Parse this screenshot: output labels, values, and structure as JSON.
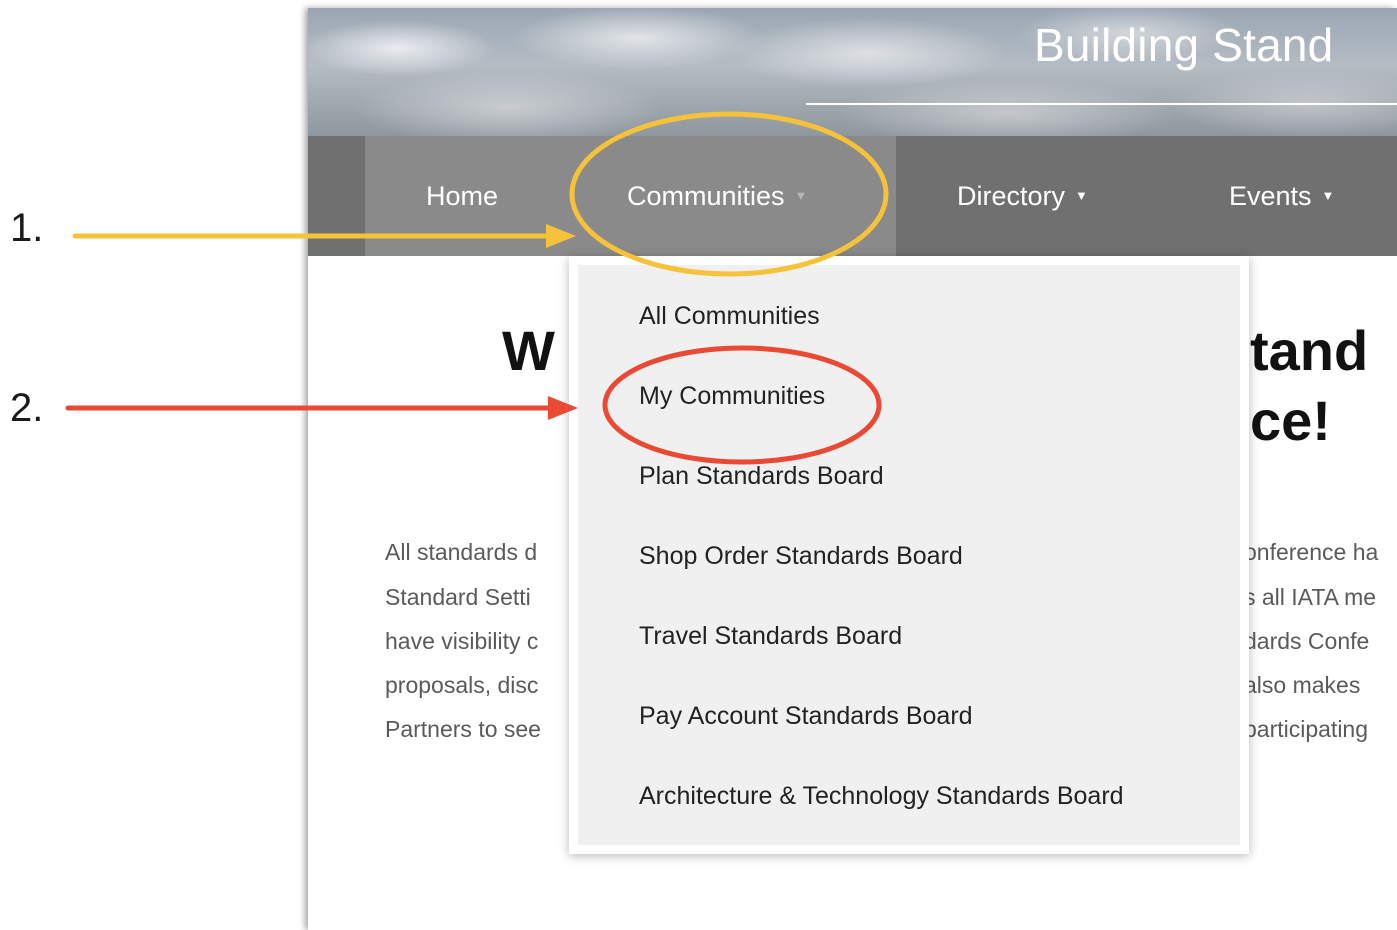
{
  "header": {
    "site_title": "Building Stand"
  },
  "nav": {
    "home": "Home",
    "communities": "Communities",
    "directory": "Directory",
    "events": "Events",
    "caret": "▼"
  },
  "main": {
    "heading_left": "W",
    "heading_right_1": "tand",
    "heading_right_2": "ce!",
    "body_left": [
      "All standards d",
      "Standard Setti",
      "have visibility c",
      "proposals, disc",
      "Partners to see"
    ],
    "body_right": [
      "onference ha",
      "s all IATA me",
      "dards Confe",
      "also makes",
      "participating"
    ]
  },
  "dropdown": {
    "items": [
      "All Communities",
      "My Communities",
      "Plan Standards Board",
      "Shop Order Standards Board",
      "Travel Standards Board",
      "Pay Account Standards Board",
      "Architecture & Technology Standards Board"
    ]
  },
  "annotations": {
    "step1": "1.",
    "step2": "2.",
    "step1_color": "#f5c23a",
    "step2_color": "#ea4a34"
  }
}
